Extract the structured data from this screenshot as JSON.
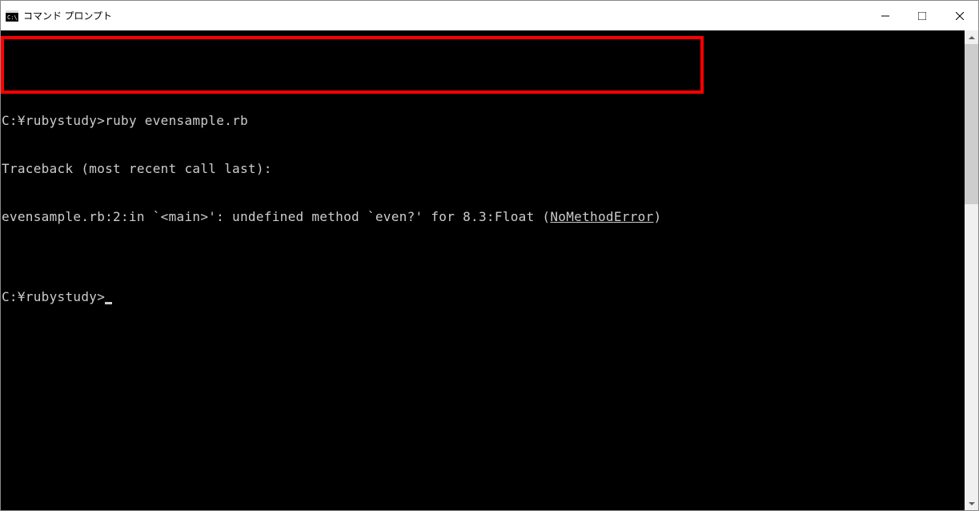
{
  "window": {
    "title": "コマンド プロンプト"
  },
  "terminal": {
    "lines": {
      "blank1": "",
      "line1_prompt": "C:¥rubystudy>",
      "line1_command": "ruby evensample.rb",
      "line2": "Traceback (most recent call last):",
      "line3_prefix": "evensample.rb:2:in `<main>': undefined method `even?' for 8.3:Float (",
      "line3_error": "NoMethodError",
      "line3_suffix": ")",
      "blank2": "",
      "line4_prompt": "C:¥rubystudy>"
    }
  }
}
